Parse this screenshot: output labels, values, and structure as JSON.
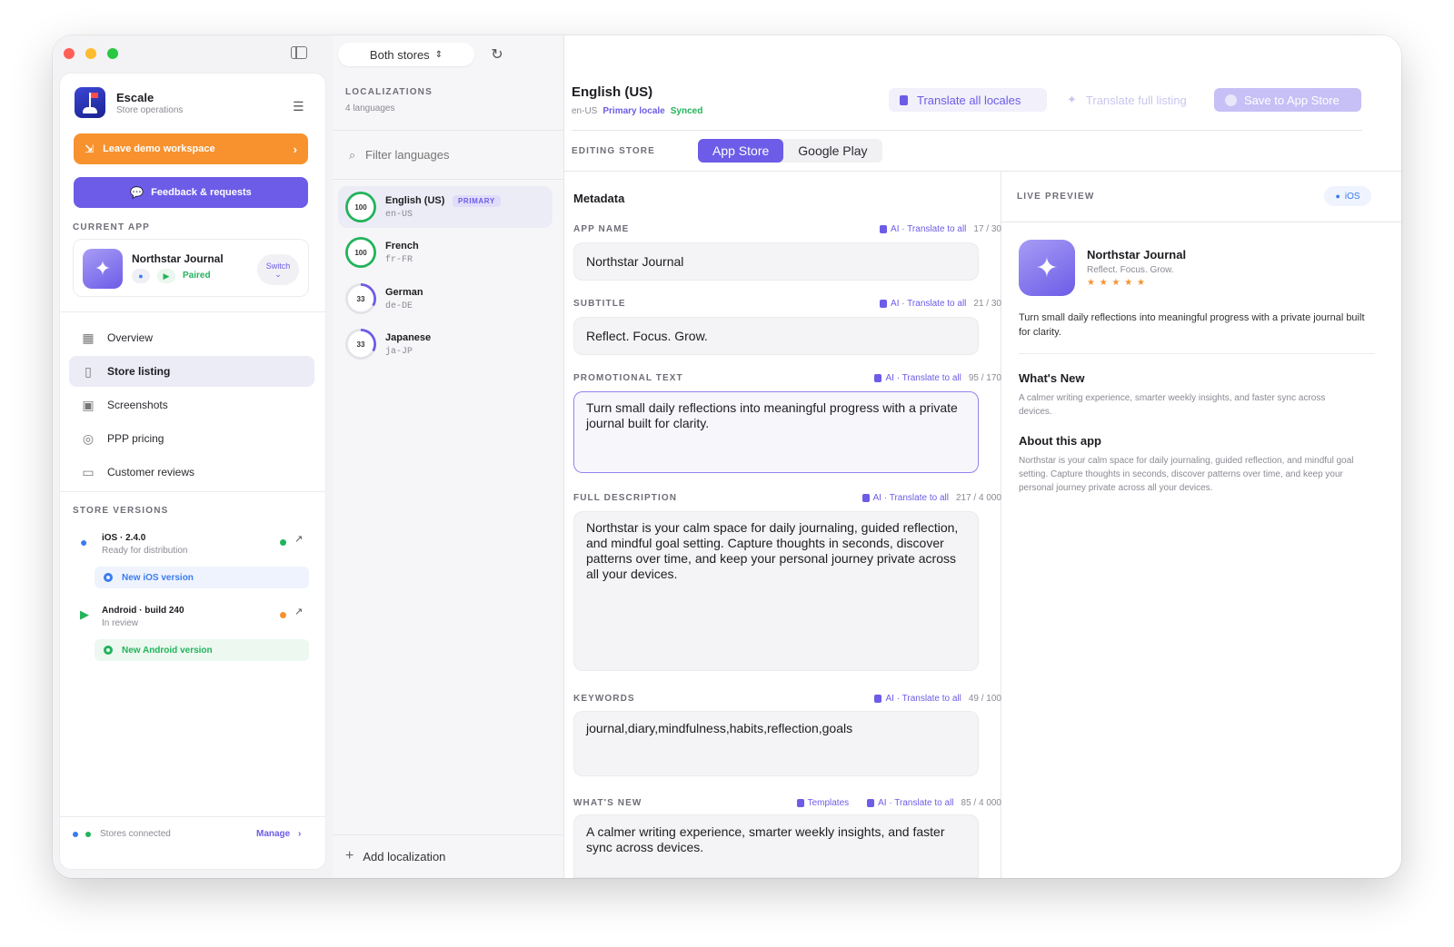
{
  "window": {
    "sidebar_title_selector": "Both stores"
  },
  "workspace": {
    "name": "Escale",
    "subtitle": "Store operations"
  },
  "buttons": {
    "leave_demo": "Leave demo workspace",
    "feedback": "Feedback & requests"
  },
  "current_app": {
    "section_label": "CURRENT APP",
    "name": "Northstar Journal",
    "status": "Paired",
    "switch_label": "Switch"
  },
  "nav": {
    "items": [
      {
        "label": "Overview",
        "icon": "grid-icon"
      },
      {
        "label": "Store listing",
        "icon": "document-icon"
      },
      {
        "label": "Screenshots",
        "icon": "images-icon"
      },
      {
        "label": "PPP pricing",
        "icon": "globe-icon"
      },
      {
        "label": "Customer reviews",
        "icon": "chat-icon"
      }
    ]
  },
  "store_versions": {
    "section_label": "STORE VERSIONS",
    "ios": {
      "title": "iOS · 2.4.0",
      "status": "Ready for distribution",
      "new_label": "New iOS version"
    },
    "android": {
      "title": "Android · build 240",
      "status": "In review",
      "new_label": "New Android version"
    }
  },
  "footer": {
    "status": "Stores connected",
    "manage": "Manage"
  },
  "localizations": {
    "section_label": "LOCALIZATIONS",
    "count": "4 languages",
    "filter_placeholder": "Filter languages",
    "items": [
      {
        "name": "English (US)",
        "code": "en-US",
        "score": "100",
        "badge": "PRIMARY",
        "percent": 100
      },
      {
        "name": "French",
        "code": "fr-FR",
        "score": "100",
        "percent": 100
      },
      {
        "name": "German",
        "code": "de-DE",
        "score": "33",
        "percent": 33
      },
      {
        "name": "Japanese",
        "code": "ja-JP",
        "score": "33",
        "percent": 33
      }
    ],
    "add_label": "Add localization"
  },
  "editor": {
    "locale_title": "English (US)",
    "locale_code": "en-US",
    "primary_label": "Primary locale",
    "synced_label": "Synced",
    "translate_all_locales": "Translate all locales",
    "translate_full_listing": "Translate full listing",
    "save_to_store": "Save to App Store",
    "editing_store_label": "EDITING STORE",
    "tabs": [
      "App Store",
      "Google Play"
    ],
    "metadata_title": "Metadata",
    "ai_translate": "AI · Translate to all",
    "templates": "Templates",
    "fields": {
      "app_name": {
        "label": "APP NAME",
        "count": "17 / 30",
        "value": "Northstar Journal"
      },
      "subtitle": {
        "label": "SUBTITLE",
        "count": "21 / 30",
        "value": "Reflect. Focus. Grow."
      },
      "promo": {
        "label": "PROMOTIONAL TEXT",
        "count": "95 / 170",
        "value": "Turn small daily reflections into meaningful progress with a private journal built for clarity."
      },
      "description": {
        "label": "FULL DESCRIPTION",
        "count": "217 / 4 000",
        "value": "Northstar is your calm space for daily journaling, guided reflection, and mindful goal setting. Capture thoughts in seconds, discover patterns over time, and keep your personal journey private across all your devices."
      },
      "keywords": {
        "label": "KEYWORDS",
        "count": "49 / 100",
        "value": "journal,diary,mindfulness,habits,reflection,goals"
      },
      "whats_new": {
        "label": "WHAT'S NEW",
        "count": "85 / 4 000",
        "value": "A calmer writing experience, smarter weekly insights, and faster sync across devices."
      }
    }
  },
  "preview": {
    "section_label": "LIVE PREVIEW",
    "platform": "iOS",
    "app_name": "Northstar Journal",
    "tagline": "Reflect. Focus. Grow.",
    "stars": "★ ★ ★ ★ ★",
    "promo": "Turn small daily reflections into meaningful progress with a private journal built for clarity.",
    "whats_new_title": "What's New",
    "whats_new_text": "A calmer writing experience, smarter weekly insights, and faster sync across devices.",
    "about_title": "About this app",
    "about_text": "Northstar is your calm space for daily journaling, guided reflection, and mindful goal setting. Capture thoughts in seconds, discover patterns over time, and keep your personal journey private across all your devices."
  },
  "colors": {
    "accent": "#6c5ce7",
    "orange": "#f7922f",
    "green": "#22b35a"
  }
}
